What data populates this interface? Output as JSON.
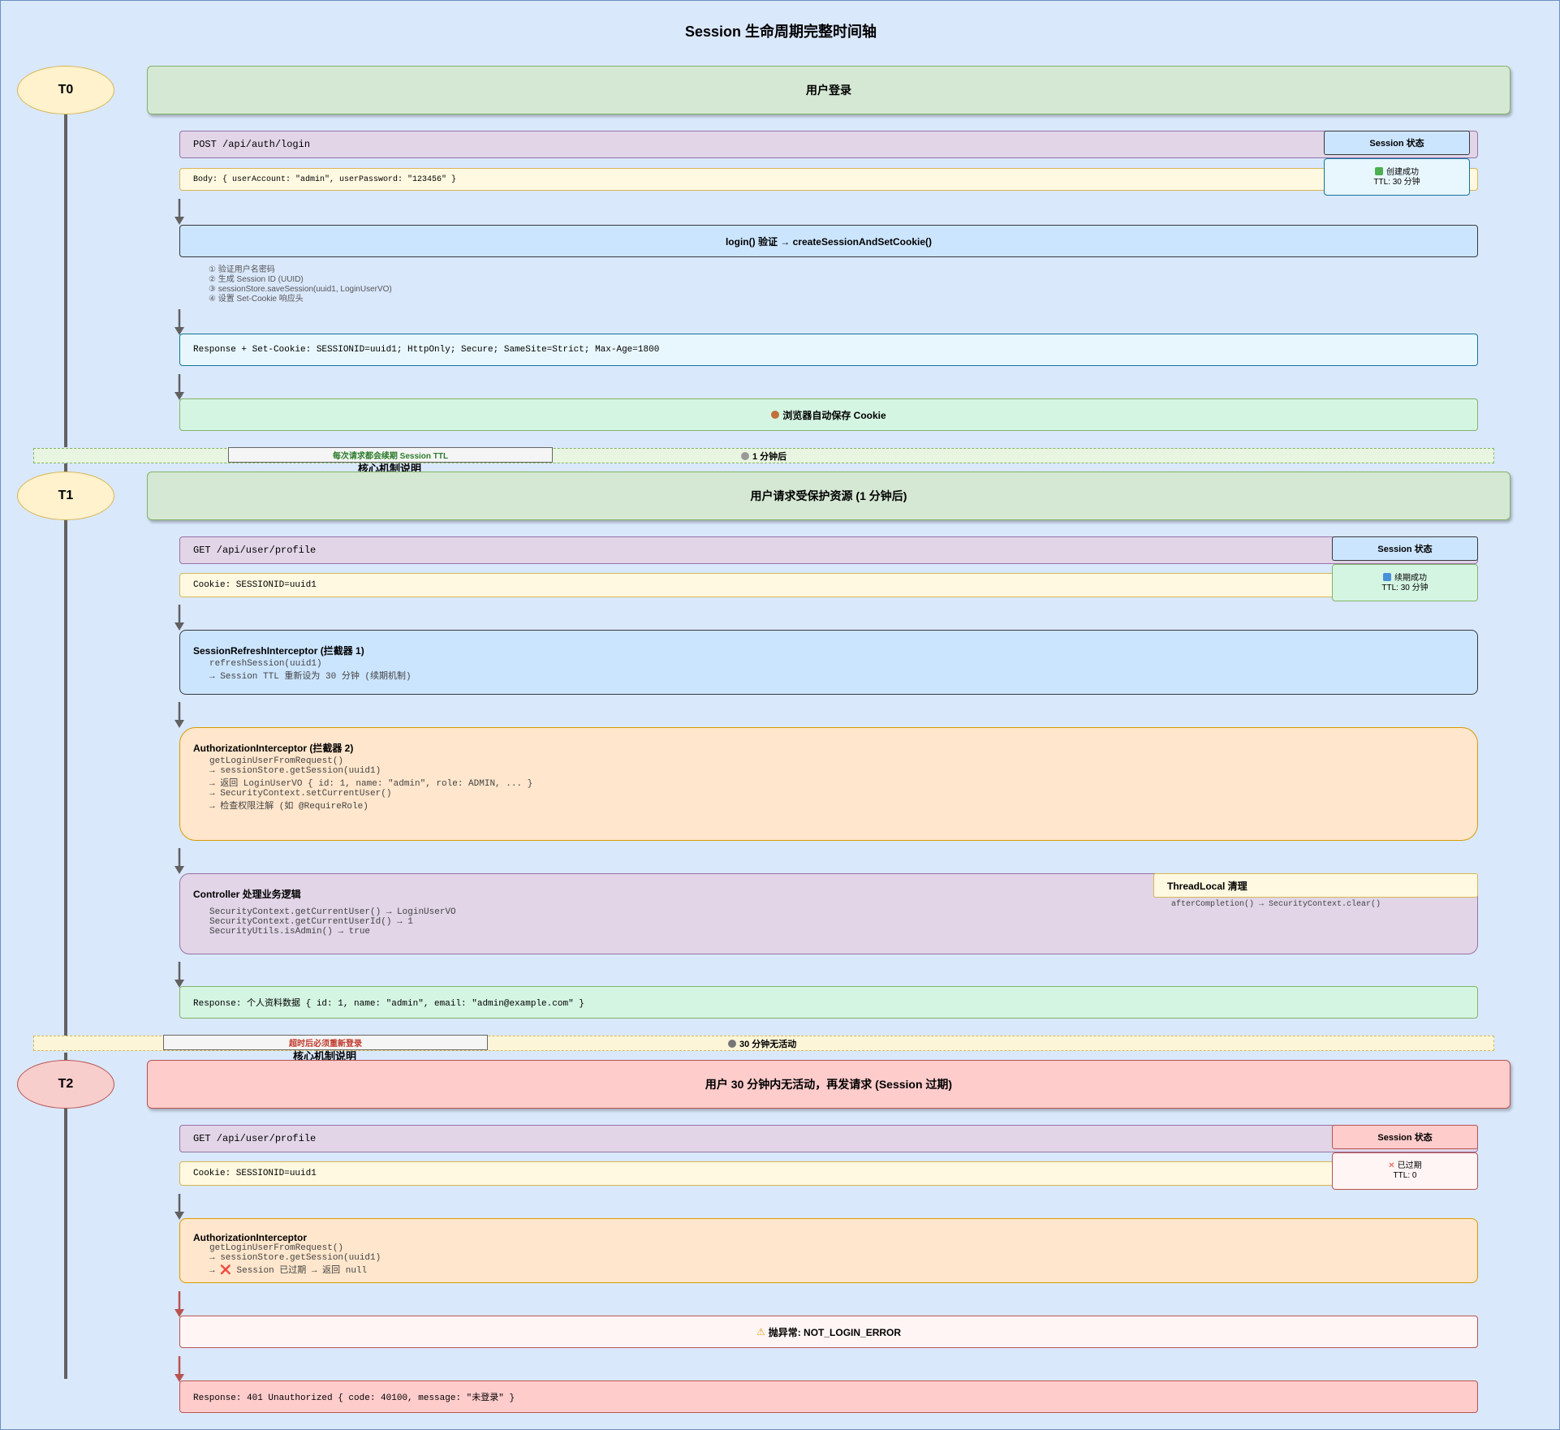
{
  "title": "Session 生命周期完整时间轴",
  "colors": {
    "canvas": "#dae8fc",
    "phase_green": "#d5e8d4",
    "phase_red": "#f8cecc",
    "request_purple": "#e1d5e7",
    "body_yellow": "#fff2cc",
    "blue": "#dae8fc",
    "orange": "#ffe6cc",
    "mint": "#d5f5e3",
    "arrow_gray": "#616161",
    "arrow_red": "#b85450"
  },
  "t0": {
    "label": "T0",
    "phase": "用户登录",
    "request": "POST /api/auth/login",
    "body": "Body: { userAccount: \"admin\", userPassword: \"123456\" }",
    "status_header": "Session 状态",
    "status_line1": "创建成功",
    "status_line2": "TTL: 30 分钟",
    "status_icon": "check-icon",
    "service": "login() 验证 → createSessionAndSetCookie()",
    "notes": [
      "① 验证用户名密码",
      "② 生成 Session ID (UUID)",
      "③ sessionStore.saveSession(uuid1, LoginUserVO)",
      "④ 设置 Set-Cookie 响应头"
    ],
    "response": "Response + Set-Cookie: SESSIONID=uuid1; HttpOnly; Secure; SameSite=Strict; Max-Age=1800",
    "browser": "浏览器自动保存 Cookie",
    "browser_icon": "cookie-icon"
  },
  "sep1": {
    "label": "1 分钟后",
    "icon": "clock-icon",
    "mechanism": "每次请求都会续期 Session TTL",
    "mechanism_title": "核心机制说明"
  },
  "t1": {
    "label": "T1",
    "phase": "用户请求受保护资源 (1 分钟后)",
    "request": "GET /api/user/profile",
    "cookie": "Cookie: SESSIONID=uuid1",
    "status_header": "Session 状态",
    "status_line1": "续期成功",
    "status_line2": "TTL: 30 分钟",
    "status_icon": "refresh-icon",
    "interceptor1_title": "SessionRefreshInterceptor (拦截器 1)",
    "interceptor1_lines": [
      "refreshSession(uuid1)",
      "→ Session TTL 重新设为 30 分钟 (续期机制)"
    ],
    "interceptor2_title": "AuthorizationInterceptor (拦截器 2)",
    "interceptor2_lines": [
      "getLoginUserFromRequest()",
      "→ sessionStore.getSession(uuid1)",
      "→ 返回 LoginUserVO { id: 1, name: \"admin\", role: ADMIN, ... }",
      "→ SecurityContext.setCurrentUser()",
      "→ 检查权限注解 (如 @RequireRole)"
    ],
    "controller_title": "Controller 处理业务逻辑",
    "controller_lines": [
      "SecurityContext.getCurrentUser() → LoginUserVO",
      "SecurityContext.getCurrentUserId() → 1",
      "SecurityUtils.isAdmin() → true"
    ],
    "threadlocal_title": "ThreadLocal 清理",
    "threadlocal_line": "afterCompletion() → SecurityContext.clear()",
    "response": "Response: 个人资料数据 { id: 1, name: \"admin\", email: \"admin@example.com\" }"
  },
  "sep2": {
    "label": "30 分钟无活动",
    "icon": "stopwatch-icon",
    "mechanism": "超时后必须重新登录",
    "mechanism_title": "核心机制说明"
  },
  "t2": {
    "label": "T2",
    "phase": "用户 30 分钟内无活动，再发请求 (Session 过期)",
    "request": "GET /api/user/profile",
    "cookie": "Cookie: SESSIONID=uuid1",
    "status_header": "Session 状态",
    "status_line1": "已过期",
    "status_line2": "TTL: 0",
    "status_icon": "cross-icon",
    "interceptor_title": "AuthorizationInterceptor",
    "interceptor_lines": [
      "getLoginUserFromRequest()",
      "→ sessionStore.getSession(uuid1)",
      "→ ❌ Session 已过期 → 返回 null"
    ],
    "exception": "抛异常: NOT_LOGIN_ERROR",
    "exception_icon": "warning-icon",
    "response": "Response: 401 Unauthorized { code: 40100, message: \"未登录\" }"
  }
}
